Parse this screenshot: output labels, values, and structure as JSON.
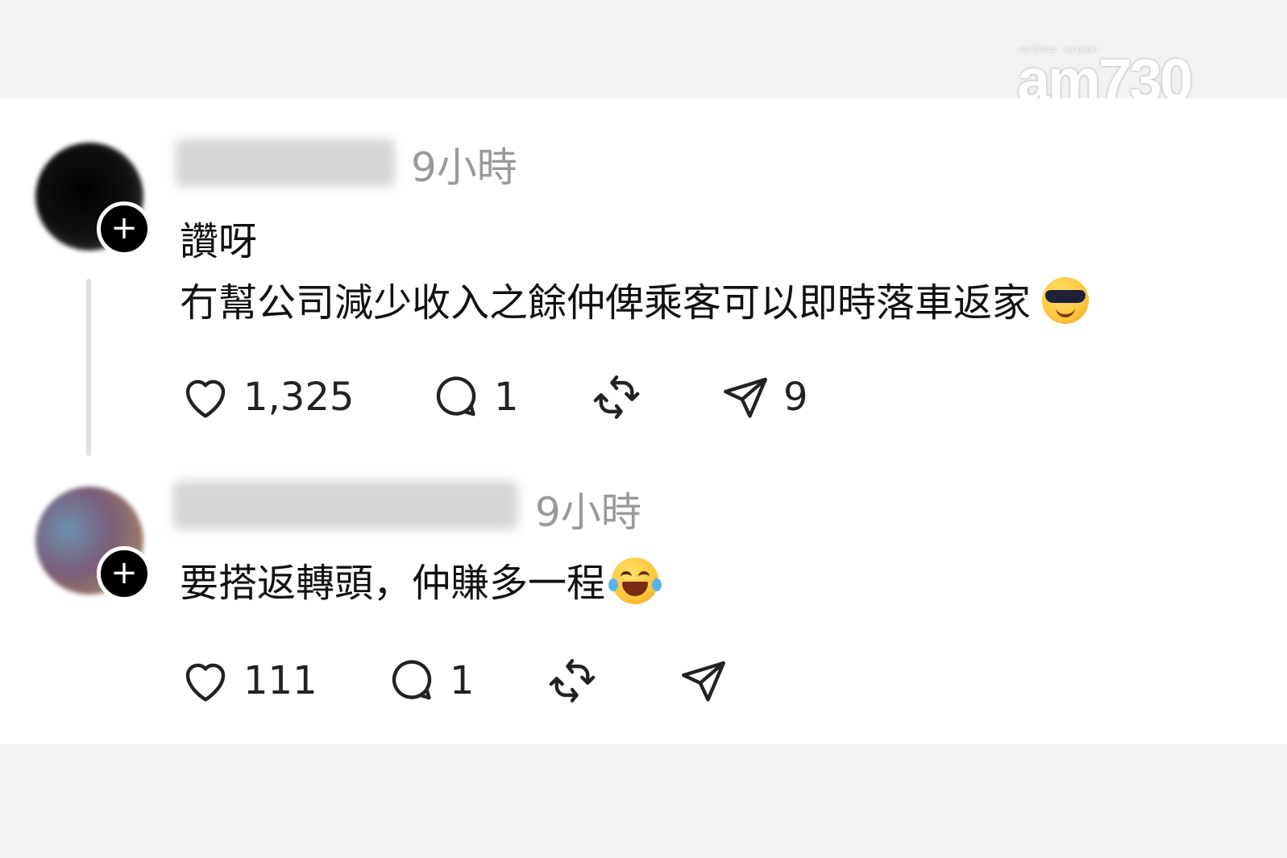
{
  "watermark": {
    "tagline": "my choice . my paper",
    "brand": "am730"
  },
  "comments": [
    {
      "time": "9小時",
      "lines": [
        "讚呀",
        "冇幫公司減少收入之餘仲俾乘客可以即時落車返家"
      ],
      "emoji": "smiling-face-with-sunglasses",
      "likes": "1,325",
      "replies": "1",
      "reposts": "",
      "shares": "9"
    },
    {
      "time": "9小時",
      "lines": [
        "要搭返轉頭，仲賺多一程"
      ],
      "emoji": "face-with-tears-of-joy",
      "likes": "111",
      "replies": "1",
      "reposts": "",
      "shares": ""
    }
  ],
  "icons": {
    "like": "heart-icon",
    "reply": "comment-bubble-icon",
    "repost": "repost-icon",
    "share": "send-icon",
    "follow": "plus-icon"
  },
  "colors": {
    "text": "#111111",
    "timestamp": "#9a9a9a",
    "background": "#ffffff",
    "follow_badge": "#000000"
  }
}
